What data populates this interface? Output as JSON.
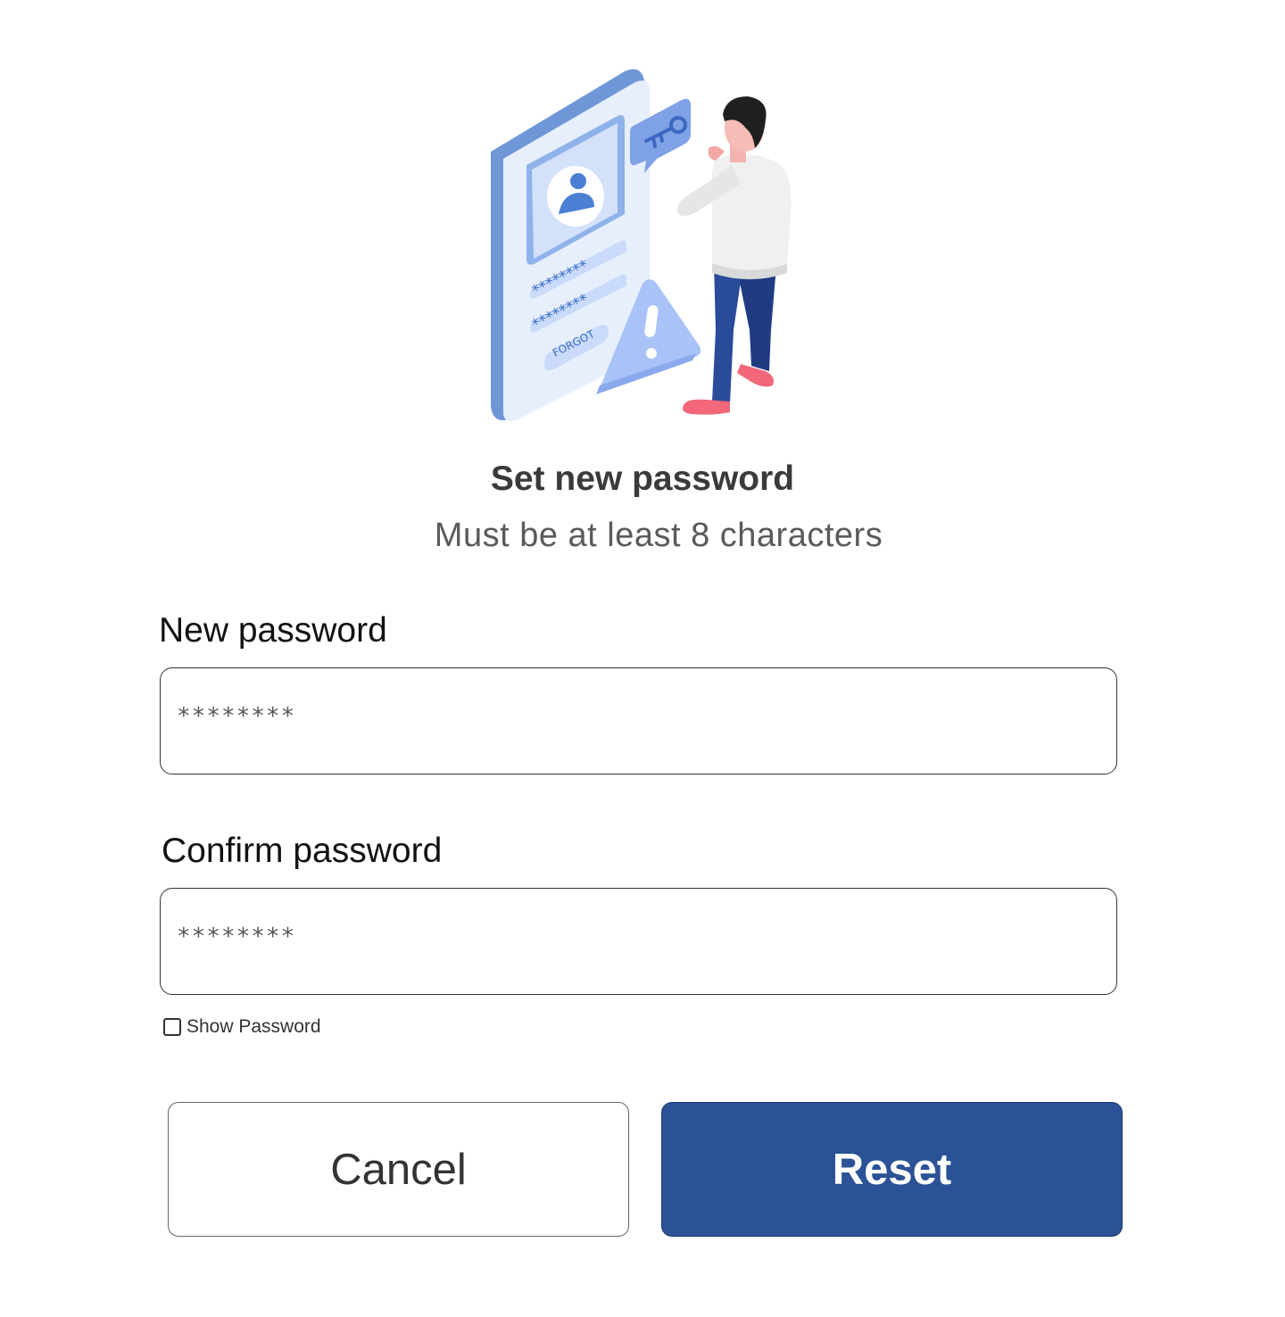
{
  "illustration": {
    "icon": "password-reset-illustration",
    "asterisks": "********",
    "forgot_label": "FORGOT"
  },
  "header": {
    "title": "Set new password",
    "subtitle": "Must be at least 8 characters"
  },
  "form": {
    "new_password": {
      "label": "New password",
      "placeholder": "********"
    },
    "confirm_password": {
      "label": "Confirm password",
      "placeholder": "********"
    },
    "show_password": {
      "label": "Show Password",
      "checked": false
    }
  },
  "actions": {
    "cancel_label": "Cancel",
    "reset_label": "Reset"
  },
  "colors": {
    "primary": "#2b5296",
    "illustration_blue": "#5b8dd9",
    "illustration_light": "#dbe7fb",
    "shoes": "#f2677a",
    "pants": "#2a4a9a"
  }
}
